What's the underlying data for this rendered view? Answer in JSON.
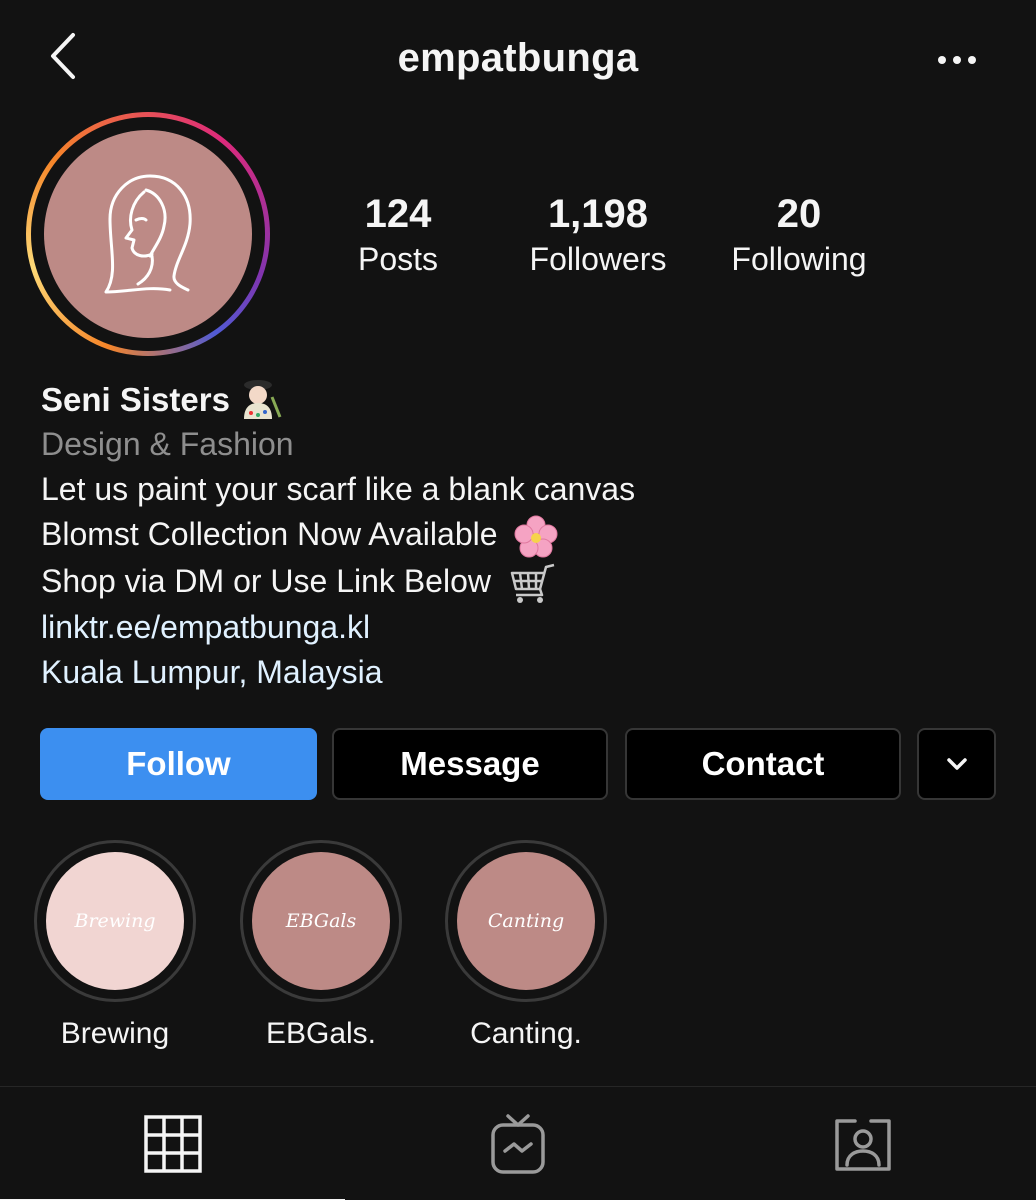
{
  "header": {
    "username": "empatbunga",
    "back_icon": "chevron-left-icon",
    "more_icon": "more-horizontal-icon"
  },
  "stats": {
    "posts": {
      "value": "124",
      "label": "Posts"
    },
    "followers": {
      "value": "1,198",
      "label": "Followers"
    },
    "following": {
      "value": "20",
      "label": "Following"
    }
  },
  "bio": {
    "name": "Seni Sisters",
    "name_emoji": "artist-emoji",
    "category": "Design & Fashion",
    "line1": "Let us paint your scarf like a blank canvas",
    "line2": "Blomst Collection Now Available",
    "line2_emoji": "cherry-blossom-emoji",
    "line3": "Shop via DM or Use Link Below",
    "line3_emoji": "shopping-cart-emoji",
    "link": "linktr.ee/empatbunga.kl",
    "location": "Kuala Lumpur, Malaysia"
  },
  "actions": {
    "follow": "Follow",
    "message": "Message",
    "contact": "Contact",
    "more_icon": "chevron-down-icon"
  },
  "highlights": [
    {
      "label": "Brewing",
      "cover_text": "Brewing",
      "color": "#f1d5d2"
    },
    {
      "label": "EBGals.",
      "cover_text": "EBGals",
      "color": "#bd8a86"
    },
    {
      "label": "Canting.",
      "cover_text": "Canting",
      "color": "#bd8a86"
    }
  ],
  "tabs": [
    {
      "name": "posts-grid",
      "icon": "grid-icon",
      "active": true
    },
    {
      "name": "igtv",
      "icon": "igtv-icon",
      "active": false
    },
    {
      "name": "tagged",
      "icon": "tagged-person-icon",
      "active": false
    }
  ],
  "colors": {
    "background": "#121212",
    "follow_blue": "#3c8ff0",
    "avatar_pink": "#bd8a86",
    "link": "#e0f1ff",
    "muted": "#8e8e8e"
  }
}
